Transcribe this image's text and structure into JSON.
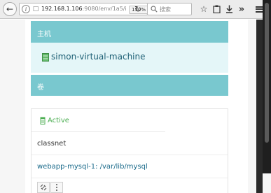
{
  "browser": {
    "url_host": "192.168.1.106",
    "url_rest": ":9080/env/1a5/i",
    "zoom": "150%",
    "search_placeholder": "搜索"
  },
  "sections": {
    "host_header": "主机",
    "host_name": "simon-virtual-machine",
    "volume_header": "卷"
  },
  "volume": {
    "status": "Active",
    "name": "classnet",
    "mount": "webapp-mysql-1: /var/lib/mysql"
  },
  "colors": {
    "header_bg": "#79c8cf",
    "host_body_bg": "#e4f6f8",
    "link": "#1a6a8a",
    "status_active": "#4cae52"
  },
  "icons": {
    "back": "back-arrow-icon",
    "info": "info-icon",
    "lock": "lock-icon",
    "reload": "reload-icon",
    "search": "search-icon",
    "bookmark": "star-icon",
    "clipboard": "clipboard-icon",
    "download": "download-icon",
    "overflow": "chevron-double-right-icon",
    "menu": "hamburger-menu-icon",
    "host": "server-icon",
    "volume_status": "trash-icon",
    "unlink": "unlink-icon",
    "actions": "kebab-menu-icon"
  }
}
